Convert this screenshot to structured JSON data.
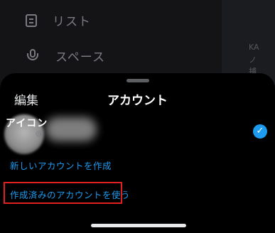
{
  "background_menu": {
    "items": [
      {
        "label": "リスト",
        "icon": "list-icon"
      },
      {
        "label": "スペース",
        "icon": "microphone-icon"
      }
    ],
    "fragments": [
      "KA",
      "ノ",
      "捕"
    ]
  },
  "sheet": {
    "edit_label": "編集",
    "title": "アカウント",
    "account": {
      "name": "アイコン",
      "handle": "@",
      "selected": true
    },
    "create_account_label": "新しいアカウントを作成",
    "use_existing_label": "作成済みのアカウントを使う"
  },
  "colors": {
    "accent": "#1d9bf0",
    "highlight": "#e02020"
  }
}
